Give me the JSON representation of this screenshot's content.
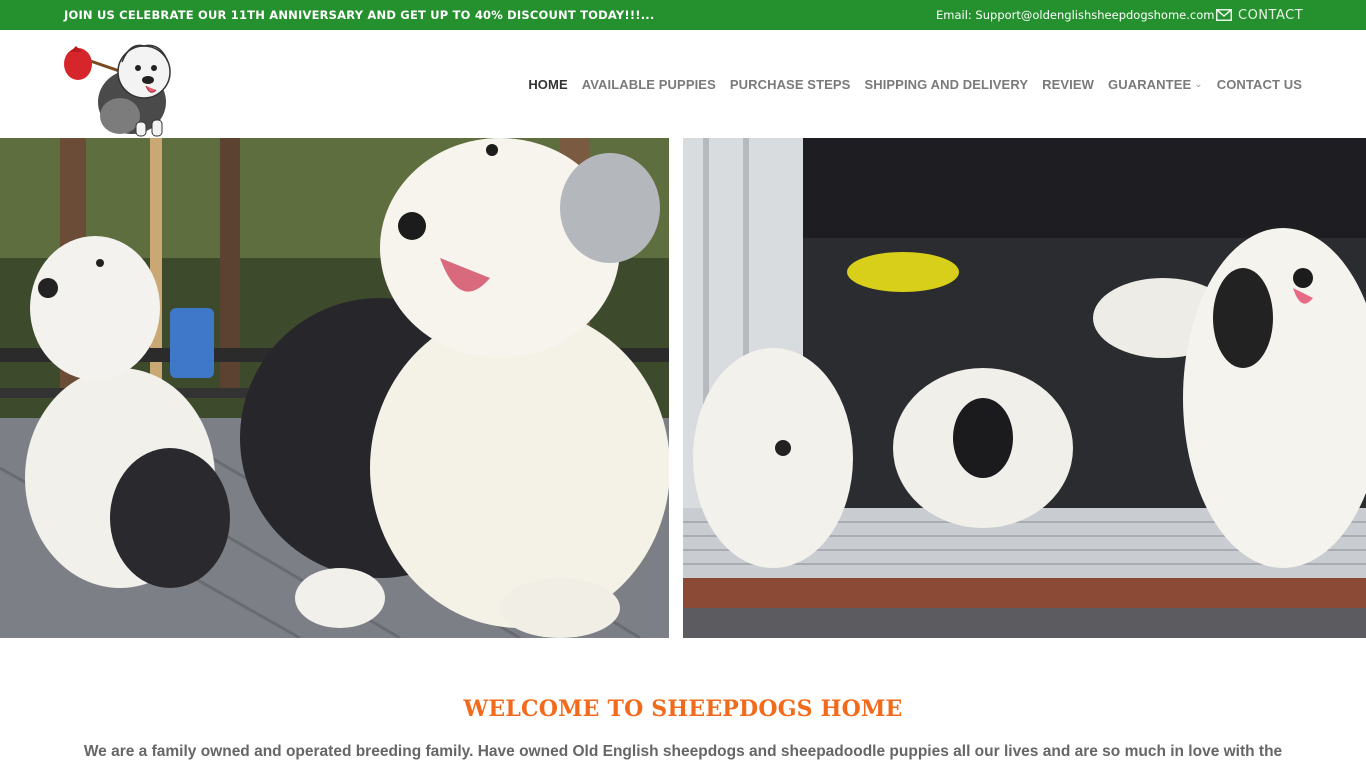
{
  "topbar": {
    "promo": "JOIN US CELEBRATE OUR 11TH ANNIVERSARY AND GET UP TO 40% DISCOUNT TODAY!!!...",
    "email": "Email: Support@oldenglishsheepdogshome.com",
    "contact_label": "CONTACT",
    "contact_icon": "envelope-icon",
    "bg_color": "#25912e"
  },
  "header": {
    "logo_icon": "sheepdog-with-bindle-logo",
    "nav": [
      {
        "label": "HOME",
        "active": true
      },
      {
        "label": "AVAILABLE PUPPIES"
      },
      {
        "label": "PURCHASE STEPS"
      },
      {
        "label": "SHIPPING AND DELIVERY"
      },
      {
        "label": "REVIEW"
      },
      {
        "label": "GUARANTEE",
        "dropdown_icon": "chevron-down-icon"
      },
      {
        "label": "CONTACT US"
      }
    ]
  },
  "hero": {
    "images": [
      {
        "name": "puppies-on-deck-photo"
      },
      {
        "name": "puppies-at-door-photo"
      }
    ]
  },
  "welcome": {
    "title": "WELCOME TO SHEEPDOGS HOME",
    "text": "We are a family owned and operated breeding family. Have owned Old English sheepdogs and sheepadoodle puppies all our lives and are so much in love with the",
    "title_color": "#f26a1b"
  }
}
